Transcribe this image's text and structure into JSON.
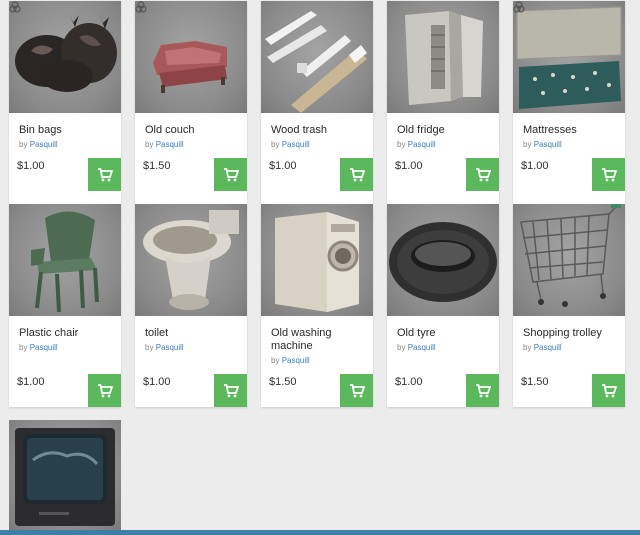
{
  "products": [
    {
      "title": "Bin bags",
      "by": "by",
      "author": "Pasquill",
      "price": "$1.00",
      "thumb_icon": "bin-bags-image"
    },
    {
      "title": "Old couch",
      "by": "by",
      "author": "Pasquill",
      "price": "$1.50",
      "thumb_icon": "old-couch-image"
    },
    {
      "title": "Wood trash",
      "by": "by",
      "author": "Pasquill",
      "price": "$1.00",
      "thumb_icon": "wood-trash-image"
    },
    {
      "title": "Old fridge",
      "by": "by",
      "author": "Pasquill",
      "price": "$1.00",
      "thumb_icon": "old-fridge-image"
    },
    {
      "title": "Mattresses",
      "by": "by",
      "author": "Pasquill",
      "price": "$1.00",
      "thumb_icon": "mattresses-image"
    },
    {
      "title": "Plastic chair",
      "by": "by",
      "author": "Pasquill",
      "price": "$1.00",
      "thumb_icon": "plastic-chair-image"
    },
    {
      "title": "toilet",
      "by": "by",
      "author": "Pasquill",
      "price": "$1.00",
      "thumb_icon": "toilet-image"
    },
    {
      "title": "Old washing machine",
      "by": "by",
      "author": "Pasquill",
      "price": "$1.50",
      "thumb_icon": "washing-machine-image"
    },
    {
      "title": "Old tyre",
      "by": "by",
      "author": "Pasquill",
      "price": "$1.00",
      "thumb_icon": "tyre-image"
    },
    {
      "title": "Shopping trolley",
      "by": "by",
      "author": "Pasquill",
      "price": "$1.50",
      "thumb_icon": "shopping-trolley-image"
    },
    {
      "title": "",
      "by": "",
      "author": "",
      "price": "",
      "thumb_icon": "old-tv-image"
    }
  ],
  "colors": {
    "cart_button": "#5cb85c",
    "author_link": "#3b7fb8",
    "bottom_bar": "#3c7fa8"
  },
  "icons": {
    "cart": "cart-icon",
    "badge": "substance-badge-icon"
  }
}
